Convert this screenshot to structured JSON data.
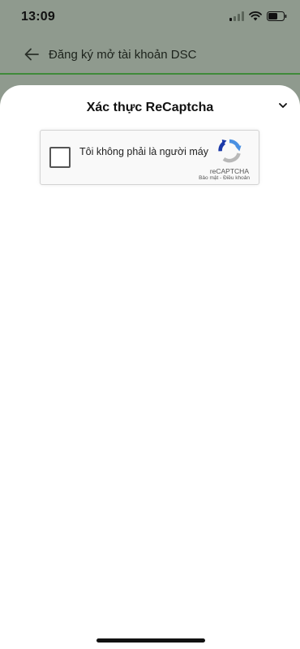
{
  "status_bar": {
    "time": "13:09"
  },
  "header": {
    "title": "Đăng ký mở tài khoản DSC"
  },
  "sheet": {
    "title": "Xác thực ReCaptcha"
  },
  "recaptcha": {
    "label": "Tôi không phải là người máy",
    "brand": "reCAPTCHA",
    "privacy_link": "Bảo mật",
    "separator": "-",
    "terms_link": "Điều khoản"
  },
  "colors": {
    "accent_green": "#3f8a3a",
    "overlay": "#8f9a8e"
  },
  "icons": {
    "back": "arrow-left-icon",
    "collapse": "chevron-down-icon",
    "recaptcha": "recaptcha-logo-icon",
    "signal": "cellular-signal-icon",
    "wifi": "wifi-icon",
    "battery": "battery-icon"
  }
}
